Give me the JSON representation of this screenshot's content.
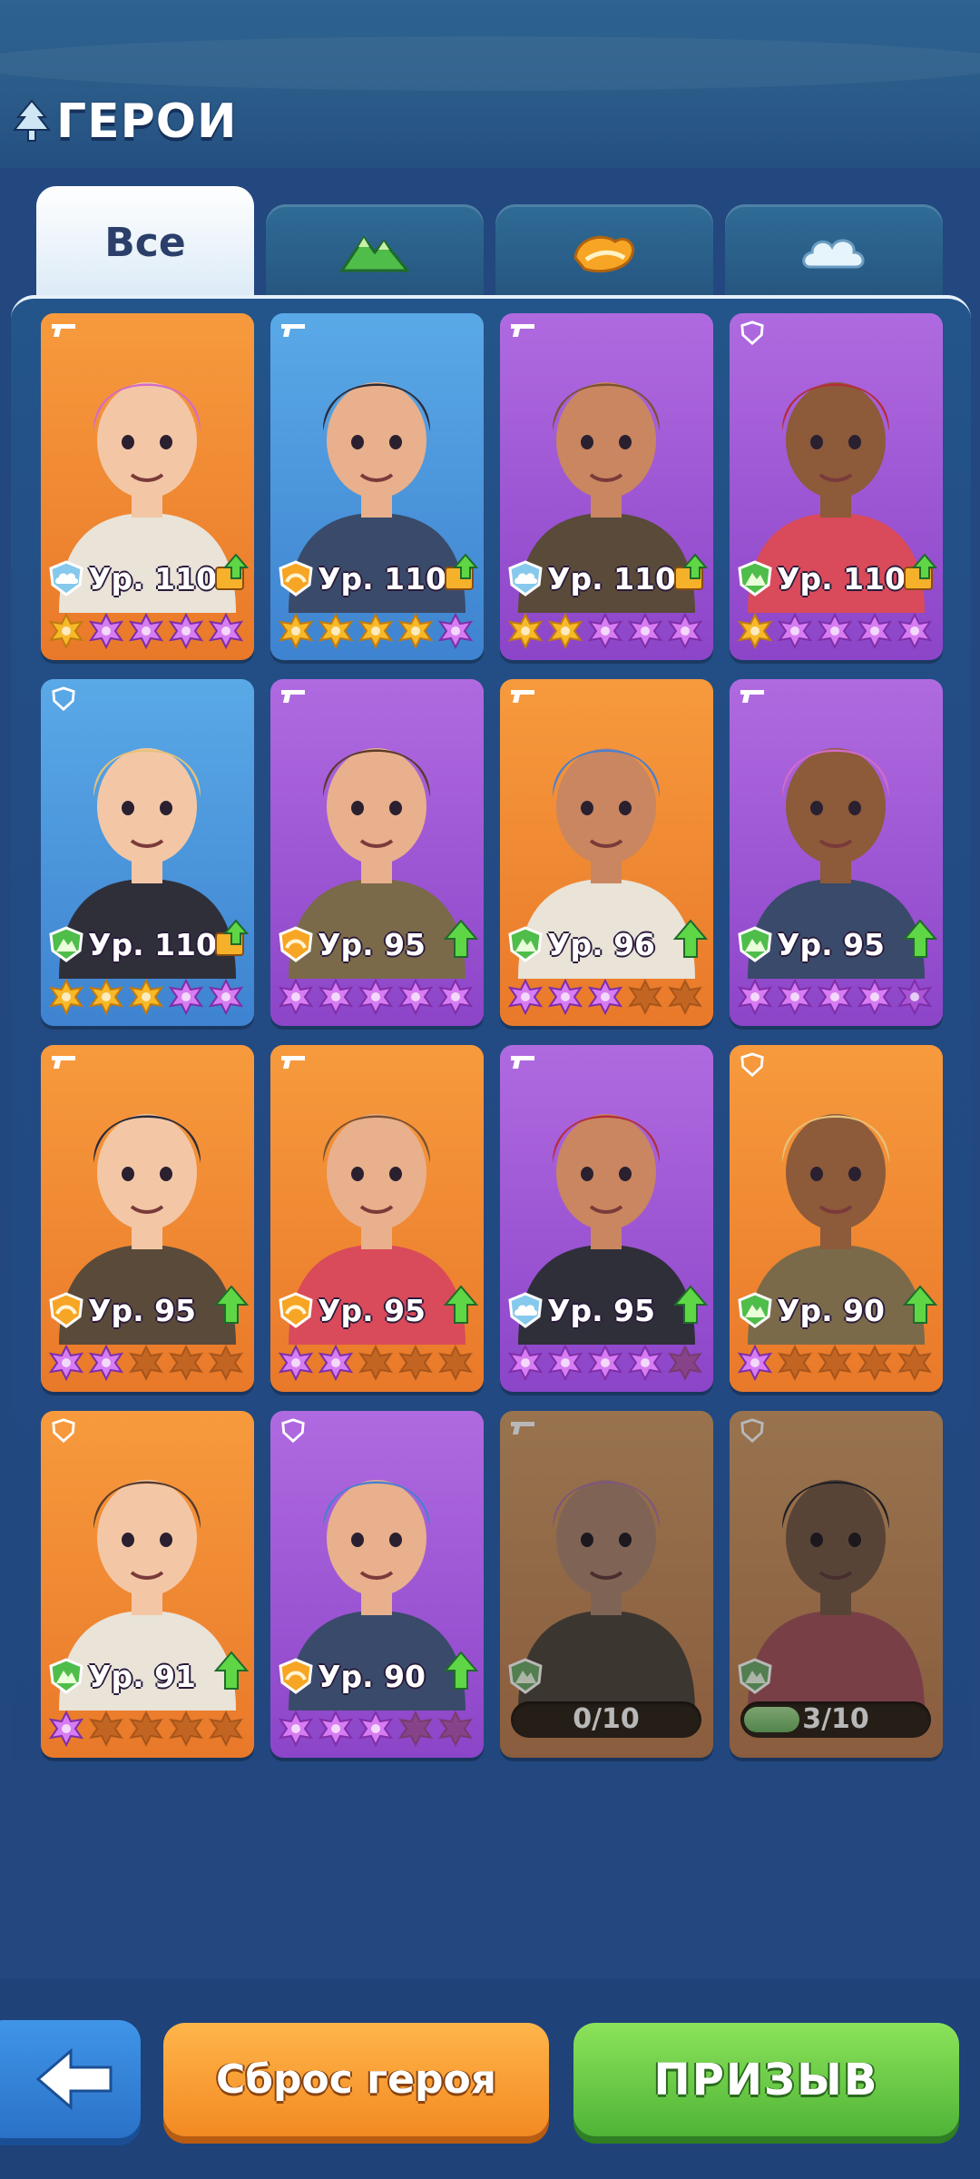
{
  "header": {
    "title": "ГЕРОИ"
  },
  "tabs": [
    {
      "label": "Все",
      "active": true
    },
    {
      "icon": "mountain-icon",
      "color": "#4fbd4a"
    },
    {
      "icon": "sun-icon",
      "color": "#f7a524"
    },
    {
      "icon": "cloud-icon",
      "color": "#cfe8f8"
    }
  ],
  "heroes": [
    {
      "level": "Ур. 110",
      "element": "cloud",
      "color": "orange",
      "weapon": "pistol",
      "stars": [
        "gold",
        "purple",
        "purple",
        "purple",
        "purple"
      ],
      "upgrade": true,
      "upgrade_style": "book"
    },
    {
      "level": "Ур. 110",
      "element": "sun",
      "color": "blue",
      "weapon": "pistol",
      "stars": [
        "gold",
        "gold",
        "gold",
        "gold",
        "purple"
      ],
      "upgrade": true,
      "upgrade_style": "book"
    },
    {
      "level": "Ур. 110",
      "element": "cloud",
      "color": "purple",
      "weapon": "pistol",
      "stars": [
        "gold",
        "gold",
        "purple",
        "purple",
        "purple"
      ],
      "upgrade": true,
      "upgrade_style": "book"
    },
    {
      "level": "Ур. 110",
      "element": "mountain",
      "color": "purple",
      "weapon": "shield",
      "stars": [
        "gold",
        "purple",
        "purple",
        "purple",
        "purple"
      ],
      "upgrade": true,
      "upgrade_style": "book"
    },
    {
      "level": "Ур. 110",
      "element": "mountain",
      "color": "blue",
      "weapon": "shield",
      "stars": [
        "gold",
        "gold",
        "gold",
        "purple",
        "purple"
      ],
      "upgrade": true,
      "upgrade_style": "book"
    },
    {
      "level": "Ур. 95",
      "element": "sun",
      "color": "purple",
      "weapon": "pistol",
      "stars": [
        "purple",
        "purple",
        "purple",
        "purple",
        "purple"
      ],
      "upgrade": true,
      "upgrade_style": "arrow"
    },
    {
      "level": "Ур. 96",
      "element": "mountain",
      "color": "orange",
      "weapon": "pistol",
      "stars": [
        "purple",
        "purple",
        "purple",
        "empty",
        "empty"
      ],
      "upgrade": true,
      "upgrade_style": "arrow"
    },
    {
      "level": "Ур. 95",
      "element": "mountain",
      "color": "purple",
      "weapon": "pistol",
      "stars": [
        "purple",
        "purple",
        "purple",
        "purple",
        "half"
      ],
      "upgrade": true,
      "upgrade_style": "arrow"
    },
    {
      "level": "Ур. 95",
      "element": "sun",
      "color": "orange",
      "weapon": "pistol",
      "stars": [
        "purple",
        "purple",
        "empty",
        "empty",
        "empty"
      ],
      "upgrade": true,
      "upgrade_style": "arrow"
    },
    {
      "level": "Ур. 95",
      "element": "sun",
      "color": "orange",
      "weapon": "pistol",
      "stars": [
        "purple",
        "purple",
        "empty",
        "empty",
        "empty"
      ],
      "upgrade": true,
      "upgrade_style": "arrow"
    },
    {
      "level": "Ур. 95",
      "element": "cloud",
      "color": "purple",
      "weapon": "pistol",
      "stars": [
        "purple",
        "purple",
        "purple",
        "purple",
        "empty"
      ],
      "upgrade": true,
      "upgrade_style": "arrow"
    },
    {
      "level": "Ур. 90",
      "element": "mountain",
      "color": "orange",
      "weapon": "shield",
      "stars": [
        "purple",
        "empty",
        "empty",
        "empty",
        "empty"
      ],
      "upgrade": true,
      "upgrade_style": "arrow"
    },
    {
      "level": "Ур. 91",
      "element": "mountain",
      "color": "orange",
      "weapon": "shield",
      "stars": [
        "purple",
        "empty",
        "empty",
        "empty",
        "empty"
      ],
      "upgrade": true,
      "upgrade_style": "arrow"
    },
    {
      "level": "Ур. 90",
      "element": "sun",
      "color": "purple",
      "weapon": "shield",
      "stars": [
        "purple",
        "purple",
        "purple",
        "empty",
        "empty"
      ],
      "upgrade": true,
      "upgrade_style": "arrow"
    },
    {
      "element": "mountain",
      "color": "orange",
      "weapon": "pistol",
      "locked": true,
      "progress": "0/10",
      "progress_fraction": 0.0
    },
    {
      "element": "mountain",
      "color": "orange",
      "weapon": "shield",
      "locked": true,
      "progress": "3/10",
      "progress_fraction": 0.3
    }
  ],
  "bottom": {
    "back_icon": "arrow-left-icon",
    "reset_label": "Сброс героя",
    "summon_label": "ПРИЗЫВ"
  },
  "colors": {
    "background": "#23477f",
    "orange_card": "#f08a33",
    "blue_card": "#4c96dc",
    "purple_card": "#9d57d4",
    "star_gold": "#f7b928",
    "star_purple": "#d77cf2",
    "upgrade_green": "#5ed645"
  }
}
